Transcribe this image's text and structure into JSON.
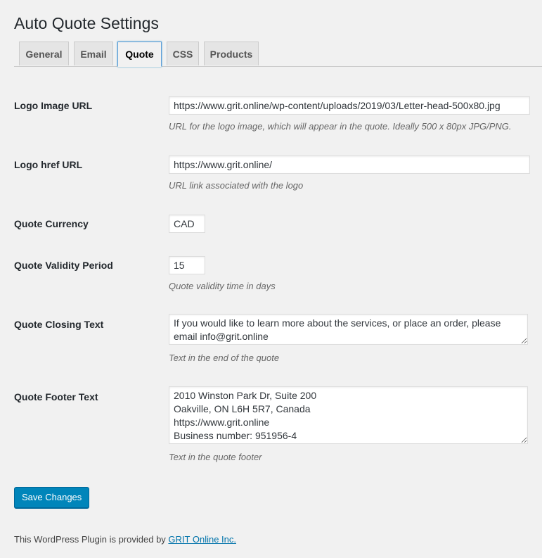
{
  "page": {
    "title": "Auto Quote Settings"
  },
  "tabs": [
    {
      "label": "General"
    },
    {
      "label": "Email"
    },
    {
      "label": "Quote",
      "active": true
    },
    {
      "label": "CSS"
    },
    {
      "label": "Products"
    }
  ],
  "fields": {
    "logo_image_url": {
      "label": "Logo Image URL",
      "value": "https://www.grit.online/wp-content/uploads/2019/03/Letter-head-500x80.jpg",
      "description": "URL for the logo image, which will appear in the quote. Ideally 500 x 80px JPG/PNG."
    },
    "logo_href_url": {
      "label": "Logo href URL",
      "value": "https://www.grit.online/",
      "description": "URL link associated with the logo"
    },
    "quote_currency": {
      "label": "Quote Currency",
      "value": "CAD"
    },
    "quote_validity_period": {
      "label": "Quote Validity Period",
      "value": "15",
      "description": "Quote validity time in days"
    },
    "quote_closing_text": {
      "label": "Quote Closing Text",
      "value": "If you would like to learn more about the services, or place an order, please email info@grit.online",
      "description": "Text in the end of the quote"
    },
    "quote_footer_text": {
      "label": "Quote Footer Text",
      "value": "2010 Winston Park Dr, Suite 200\nOakville, ON L6H 5R7, Canada\nhttps://www.grit.online\nBusiness number: 951956-4",
      "description": "Text in the quote footer"
    }
  },
  "actions": {
    "save_label": "Save Changes"
  },
  "footer": {
    "text": "This WordPress Plugin is provided by ",
    "link_text": "GRIT Online Inc."
  },
  "colors": {
    "primary_button": "#0085ba",
    "link": "#0073aa",
    "background": "#f1f1f1"
  }
}
